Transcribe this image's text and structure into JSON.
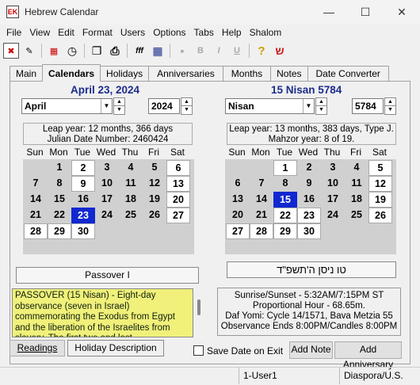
{
  "window": {
    "title": "Hebrew Calendar",
    "icon_label": "EK",
    "minimize": "—",
    "maximize": "☐",
    "close": "✕"
  },
  "menu": [
    "File",
    "View",
    "Edit",
    "Format",
    "Users",
    "Options",
    "Tabs",
    "Help",
    "Shalom"
  ],
  "toolbar": {
    "buttons": [
      {
        "icon": "exit-icon",
        "glyph": "✖"
      },
      {
        "icon": "wand-icon",
        "glyph": "✎"
      },
      {
        "icon": "calendar-exit-icon",
        "glyph": "▦"
      },
      {
        "icon": "clock-icon",
        "glyph": "◷"
      },
      {
        "icon": "copy-icon",
        "glyph": "❐"
      },
      {
        "icon": "print-icon",
        "glyph": "⎙"
      },
      {
        "icon": "font-icon",
        "glyph": "fff"
      },
      {
        "icon": "grid-icon",
        "glyph": "▦"
      },
      {
        "icon": "save-icon",
        "glyph": "▪"
      },
      {
        "icon": "bold-icon",
        "glyph": "B"
      },
      {
        "icon": "italic-icon",
        "glyph": "I"
      },
      {
        "icon": "underline-icon",
        "glyph": "U"
      },
      {
        "icon": "help-icon",
        "glyph": "?"
      },
      {
        "icon": "shalom-icon",
        "glyph": "ש"
      }
    ]
  },
  "tabs": [
    "Main",
    "Calendars",
    "Holidays",
    "Anniversaries",
    "Months",
    "Notes",
    "Date Converter"
  ],
  "active_tab": "Calendars",
  "gregorian": {
    "title": "April 23, 2024",
    "month": "April",
    "year": "2024",
    "info_line1": "Leap year: 12 months, 366 days",
    "info_line2": "Julian Date Number: 2460424",
    "day_headers": [
      "Sun",
      "Mon",
      "Tue",
      "Wed",
      "Thu",
      "Fri",
      "Sat"
    ],
    "weeks": [
      [
        "",
        "1",
        "2",
        "3",
        "4",
        "5",
        "6"
      ],
      [
        "7",
        "8",
        "9",
        "10",
        "11",
        "12",
        "13"
      ],
      [
        "14",
        "15",
        "16",
        "17",
        "18",
        "19",
        "20"
      ],
      [
        "21",
        "22",
        "23",
        "24",
        "25",
        "26",
        "27"
      ],
      [
        "28",
        "29",
        "30",
        "",
        "",
        "",
        ""
      ]
    ],
    "selected": "23",
    "holiday_label": "Passover I"
  },
  "hebrew": {
    "title": "15 Nisan 5784",
    "month": "Nisan",
    "year": "5784",
    "info_line1": "Leap year: 13 months, 383 days, Type J.",
    "info_line2": "Mahzor year: 8 of 19.",
    "day_headers": [
      "Sun",
      "Mon",
      "Tue",
      "Wed",
      "Thu",
      "Fri",
      "Sat"
    ],
    "weeks": [
      [
        "",
        "",
        "1",
        "2",
        "3",
        "4",
        "5"
      ],
      [
        "6",
        "7",
        "8",
        "9",
        "10",
        "11",
        "12"
      ],
      [
        "13",
        "14",
        "15",
        "16",
        "17",
        "18",
        "19"
      ],
      [
        "20",
        "21",
        "22",
        "23",
        "24",
        "25",
        "26"
      ],
      [
        "27",
        "28",
        "29",
        "30",
        "",
        "",
        ""
      ]
    ],
    "selected": "15",
    "hebrew_date_text": "טו ניסן ה'תשפ\"ד"
  },
  "description": "PASSOVER (15 Nisan) - Eight-day observance (seven in Israel) commemorating the Exodus from Egypt and the liberation of the Israelites from slavery. The first two and last",
  "sun_info": {
    "line1": "Sunrise/Sunset - 5:32AM/7:15PM ST",
    "line2": "Proportional Hour - 68.65m.",
    "line3": "Daf Yomi: Cycle 14/1571, Bava Metzia 55",
    "line4": "Observance Ends 8:00PM/Candles 8:00PM"
  },
  "buttons": {
    "readings": "Readings",
    "holiday_description": "Holiday Description",
    "save_date": "Save Date on Exit",
    "add_note": "Add Note",
    "add_anniversary": "Add Anniversary"
  },
  "status": {
    "user": "1-User1",
    "location": "Diaspora/U.S."
  },
  "colors": {
    "accent": "#1028d0",
    "title": "#1c2c8c",
    "highlight": "#f0f07a"
  }
}
